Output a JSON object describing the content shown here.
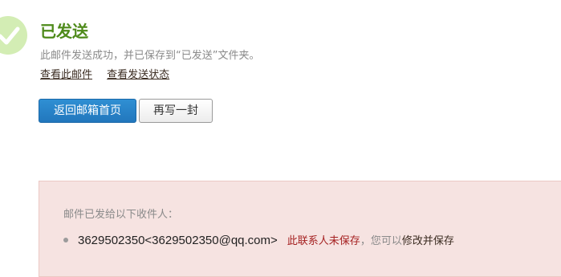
{
  "status": {
    "title": "已发送",
    "description": "此邮件发送成功，并已保存到“已发送”文件夹。",
    "icon": "check-circle-icon"
  },
  "links": {
    "view_mail": "查看此邮件",
    "view_status": "查看发送状态"
  },
  "buttons": {
    "back_home": "返回邮箱首页",
    "write_again": "再写一封"
  },
  "recipients": {
    "label": "邮件已发给以下收件人：",
    "items": [
      {
        "address": "3629502350<3629502350@qq.com>",
        "warning": "此联系人未保存",
        "hint": "，您可以",
        "action": "修改并保存"
      }
    ]
  },
  "colors": {
    "title_green": "#4e8a1a",
    "primary_button": "#2277bd",
    "panel_background": "#f6e3e1",
    "warning_red": "#a52121"
  }
}
